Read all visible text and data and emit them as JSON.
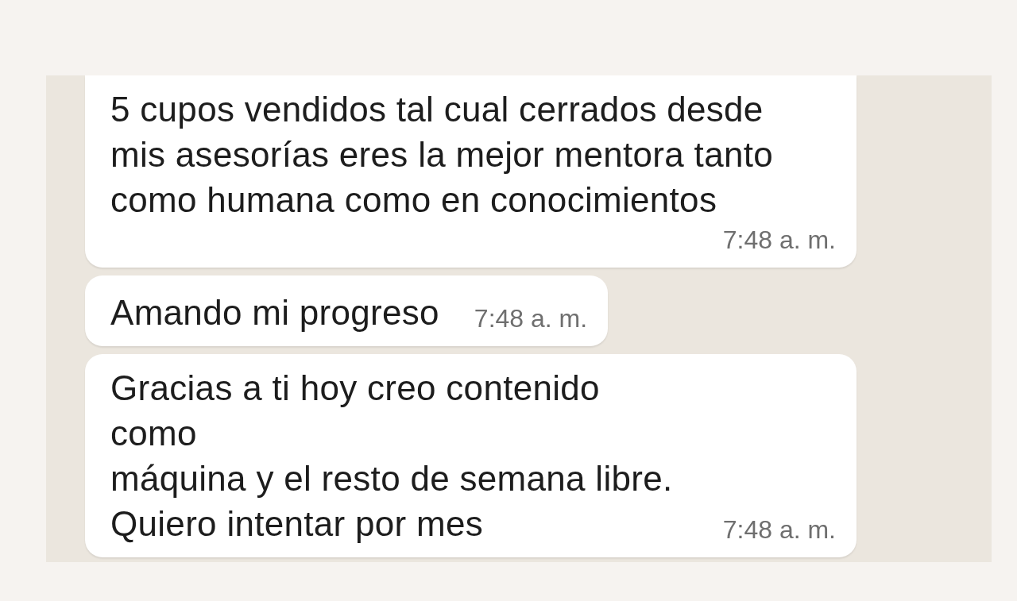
{
  "messages": [
    {
      "text": "5 cupos vendidos tal cual cerrados desde\nmis asesorías eres la mejor mentora tanto\ncomo humana como en conocimientos",
      "time": "7:48 a. m.",
      "kind": "below"
    },
    {
      "text": "Amando mi progreso",
      "time": "7:48 a. m.",
      "kind": "inline"
    },
    {
      "text": "Gracias a ti hoy creo contenido como\nmáquina y el resto de semana libre.\nQuiero intentar por mes",
      "time": "7:48 a. m.",
      "kind": "end"
    }
  ]
}
